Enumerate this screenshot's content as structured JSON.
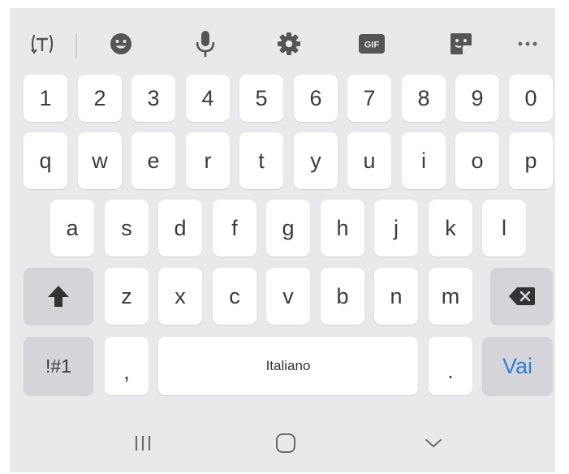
{
  "toolbar": {
    "icons": [
      "text-translate-icon",
      "emoji-icon",
      "microphone-icon",
      "settings-gear-icon",
      "gif-icon",
      "sticker-icon",
      "more-options-icon"
    ],
    "gif_label": "GIF"
  },
  "rows": {
    "numbers": [
      "1",
      "2",
      "3",
      "4",
      "5",
      "6",
      "7",
      "8",
      "9",
      "0"
    ],
    "top": [
      "q",
      "w",
      "e",
      "r",
      "t",
      "y",
      "u",
      "i",
      "o",
      "p"
    ],
    "middle": [
      "a",
      "s",
      "d",
      "f",
      "g",
      "h",
      "j",
      "k",
      "l"
    ],
    "bottom": [
      "z",
      "x",
      "c",
      "v",
      "b",
      "n",
      "m"
    ]
  },
  "special": {
    "symbols_label": "!#1",
    "comma_label": ",",
    "space_label": "Italiano",
    "period_label": ".",
    "go_label": "Vai"
  },
  "colors": {
    "background": "#e9e9eb",
    "key": "#ffffff",
    "special_key": "#d5d5d9",
    "accent": "#2e7fd3",
    "icon": "#555555"
  },
  "navbar": {
    "icons": [
      "recent-apps-icon",
      "home-icon",
      "hide-keyboard-icon"
    ]
  }
}
